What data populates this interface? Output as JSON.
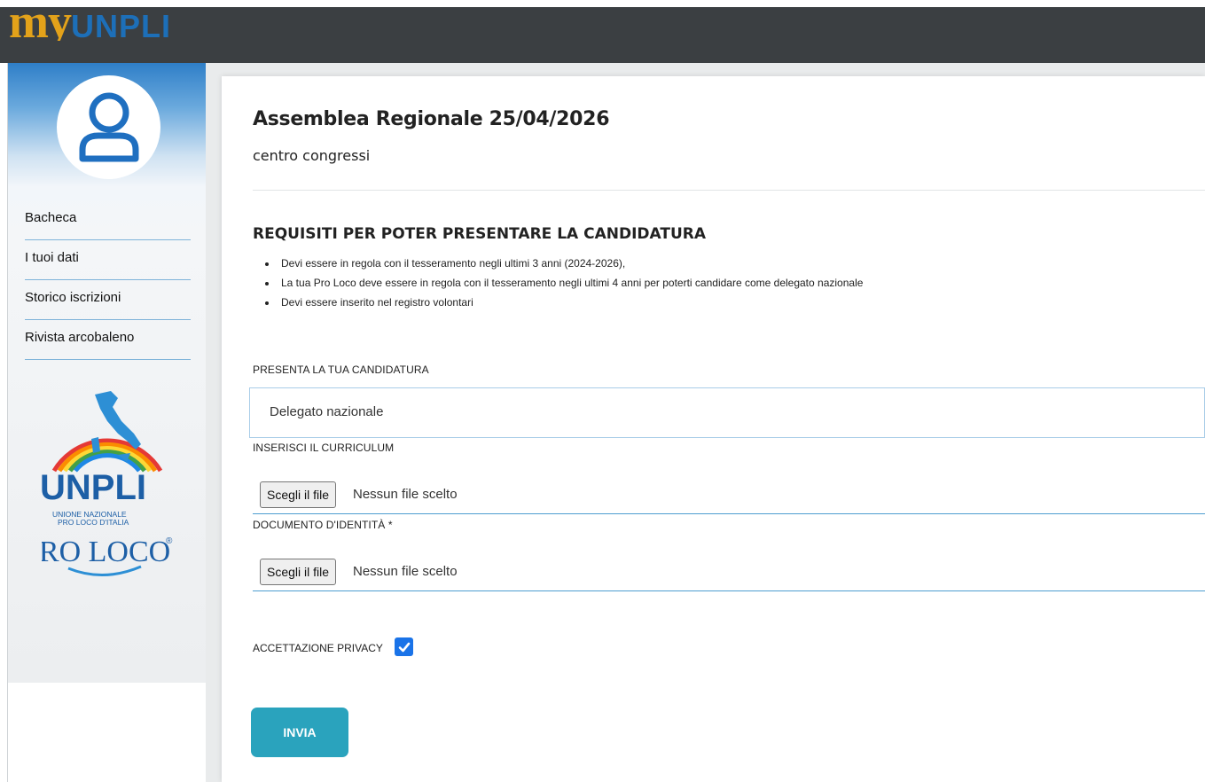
{
  "app": {
    "brand_my": "my",
    "brand_unpli": "UNPLI"
  },
  "sidebar": {
    "items": [
      {
        "label": "Bacheca"
      },
      {
        "label": "I tuoi dati"
      },
      {
        "label": "Storico iscrizioni"
      },
      {
        "label": "Rivista arcobaleno"
      }
    ],
    "logo": {
      "unpli": "UNPLI",
      "line1": "UNIONE NAZIONALE",
      "line2": "PRO LOCO D'ITALIA",
      "proloco": "PRO LOCO",
      "registered": "®"
    }
  },
  "main": {
    "title": "Assemblea Regionale 25/04/2026",
    "subtitle": "centro congressi",
    "requirements": {
      "heading": "REQUISITI PER POTER PRESENTARE LA CANDIDATURA",
      "items": [
        "Devi essere in regola con il tesseramento negli ultimi 3 anni (2024-2026),",
        "La tua Pro Loco deve essere in regola con il tesseramento negli ultimi 4 anni per poterti candidare come delegato nazionale",
        "Devi essere inserito nel registro volontari"
      ]
    },
    "candidatura": {
      "label": "PRESENTA LA TUA CANDIDATURA",
      "value": "Delegato nazionale"
    },
    "curriculum": {
      "label": "INSERISCI IL CURRICULUM",
      "button": "Scegli il file",
      "status": "Nessun file scelto"
    },
    "documento": {
      "label": "DOCUMENTO D'IDENTITÀ *",
      "button": "Scegli il file",
      "status": "Nessun file scelto"
    },
    "privacy": {
      "label": "ACCETTAZIONE PRIVACY",
      "checked": true
    },
    "submit_label": "INVIA"
  },
  "colors": {
    "topbar": "#3b3f42",
    "brand_my": "#e3a21a",
    "brand_unpli": "#1d6fb8",
    "accent": "#2aa3bd",
    "checkbox": "#1a73e8"
  }
}
